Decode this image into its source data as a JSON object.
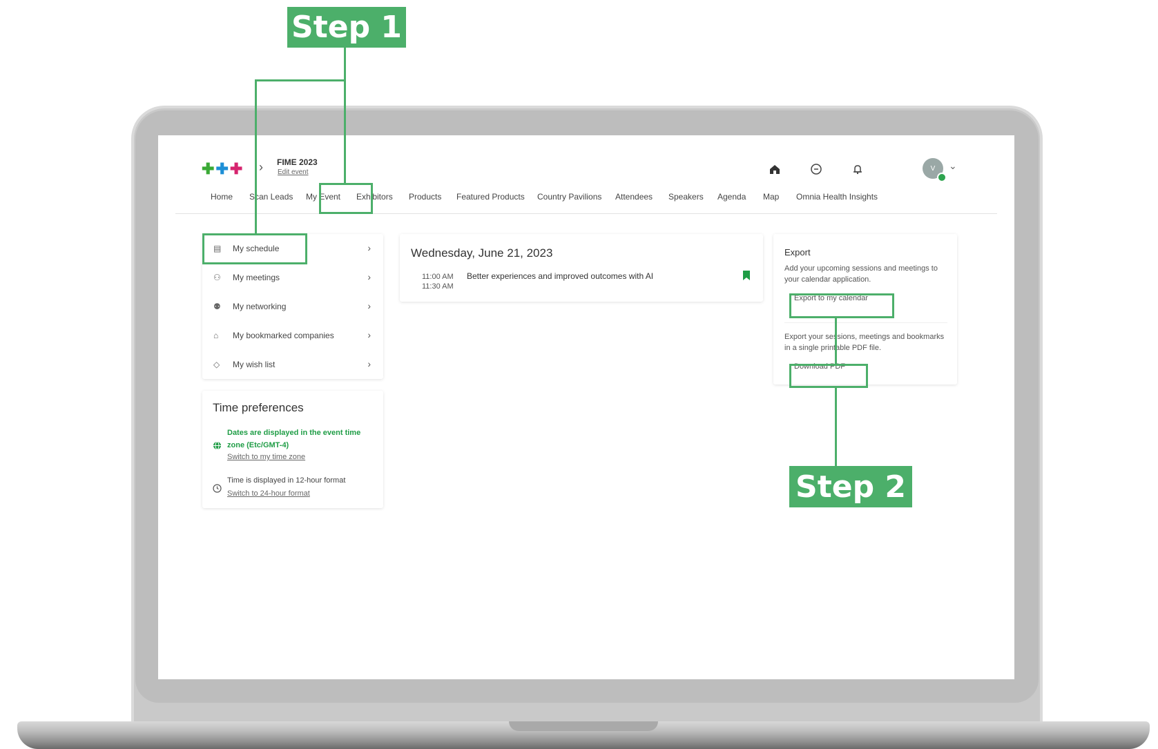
{
  "header": {
    "event_name": "FIME 2023",
    "edit_link": "Edit event",
    "avatar_initials": "V"
  },
  "nav": {
    "items": [
      "Home",
      "Scan Leads",
      "My Event",
      "Exhibitors",
      "Products",
      "Featured Products",
      "Country Pavilions",
      "Attendees",
      "Speakers",
      "Agenda",
      "Map",
      "Omnia Health Insights"
    ],
    "active": "My Event"
  },
  "sidebar": {
    "items": [
      {
        "label": "My schedule",
        "icon": "calendar-icon"
      },
      {
        "label": "My meetings",
        "icon": "meetings-icon"
      },
      {
        "label": "My networking",
        "icon": "networking-icon"
      },
      {
        "label": "My bookmarked companies",
        "icon": "building-icon"
      },
      {
        "label": "My wish list",
        "icon": "tag-icon"
      }
    ]
  },
  "time_preferences": {
    "title": "Time preferences",
    "timezone_notice": "Dates are displayed in the event time zone (Etc/GMT-4)",
    "switch_timezone": "Switch to my time zone",
    "format_notice": "Time is displayed in 12-hour format",
    "switch_format": "Switch to 24-hour format"
  },
  "schedule": {
    "date": "Wednesday, June 21, 2023",
    "sessions": [
      {
        "start": "11:00 AM",
        "end": "11:30 AM",
        "title": "Better experiences and improved outcomes with AI"
      }
    ]
  },
  "export": {
    "title": "Export",
    "calendar_text": "Add your upcoming sessions and meetings to your calendar application.",
    "calendar_button": "Export to my calendar",
    "pdf_text": "Export your sessions, meetings and bookmarks in a single printable PDF file.",
    "pdf_button": "Download PDF"
  },
  "annotations": {
    "step1": "Step 1",
    "step2": "Step 2",
    "color": "#4caf6a"
  },
  "colors": {
    "accent_green": "#1f9d46",
    "logo_green": "#3aa935",
    "logo_blue": "#1d8fd6",
    "logo_magenta": "#d6246e"
  }
}
